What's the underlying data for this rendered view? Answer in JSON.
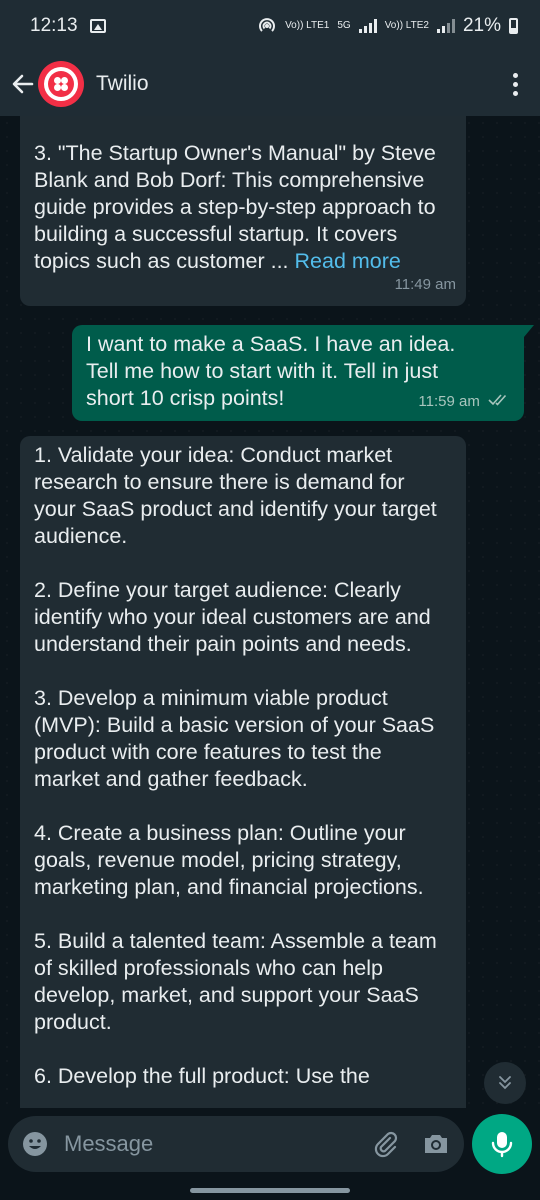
{
  "status_bar": {
    "time": "12:13",
    "lte1_label": "Vo)) LTE1",
    "net_label": "5G",
    "lte2_label": "Vo)) LTE2",
    "battery_percent": "21%"
  },
  "header": {
    "contact_name": "Twilio"
  },
  "messages": [
    {
      "direction": "incoming",
      "text": "3. \"The Startup Owner's Manual\" by Steve Blank and Bob Dorf: This comprehensive guide provides a step-by-step approach to building a successful startup. It covers topics such as customer ...",
      "read_more": "Read more",
      "time": "11:49 am"
    },
    {
      "direction": "outgoing",
      "text": "I want to make a SaaS. I have an idea. Tell me how to start with it. Tell in just short  10 crisp points!",
      "time": "11:59 am"
    },
    {
      "direction": "incoming",
      "paragraphs": [
        "1. Validate your idea: Conduct market research to ensure there is demand for your SaaS product and identify your target audience.",
        "2. Define your target audience: Clearly identify who your ideal customers are and understand their pain points and needs.",
        "3. Develop a minimum viable product (MVP): Build a basic version of your SaaS product with core features to test the market and gather feedback.",
        "4. Create a business plan: Outline your goals, revenue model, pricing strategy, marketing plan, and financial projections.",
        "5. Build a talented team: Assemble a team of skilled professionals who can help develop, market, and support your SaaS product.",
        "6. Develop the full product: Use the"
      ]
    }
  ],
  "composer": {
    "placeholder": "Message"
  },
  "colors": {
    "header_bg": "#1f2c34",
    "chat_bg": "#0b141a",
    "incoming_bubble": "#202c33",
    "outgoing_bubble": "#005c4b",
    "accent": "#00a884",
    "link": "#53bdeb",
    "avatar": "#f22f46"
  }
}
